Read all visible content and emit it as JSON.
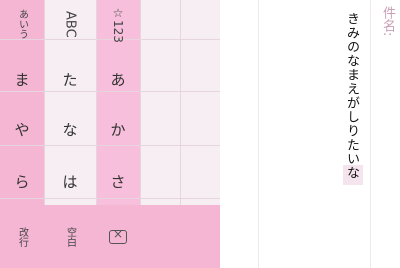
{
  "keyboard": {
    "mode_key": "☆123",
    "abc_key": "ABC",
    "kana_mode_key": "あいう",
    "rows": {
      "row1": [
        "あ",
        "か",
        "さ"
      ],
      "row2": [
        "た",
        "な",
        "は"
      ],
      "row3": [
        "ま",
        "や",
        "ら"
      ]
    },
    "space_key": "空白",
    "enter_key": "改行",
    "delete_icon": "backspace-icon"
  },
  "editor": {
    "subject_label": "件名:",
    "body_text": "きみのなまえがしりたいな"
  }
}
